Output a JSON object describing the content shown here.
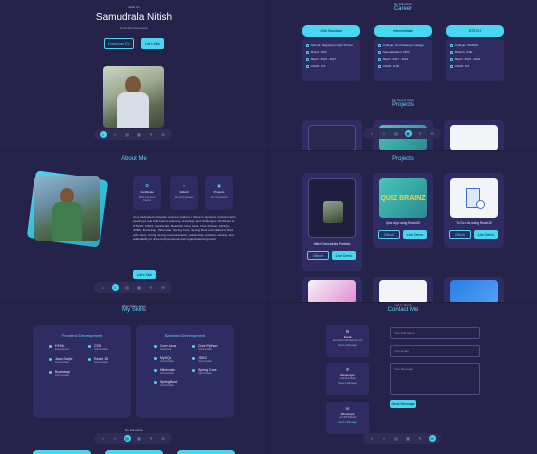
{
  "hero": {
    "greeting": "Hello I'm",
    "name": "Samudrala Nitish",
    "role": "Front-End Developer",
    "download_cv": "Download CV",
    "lets_talk": "Let's Talk"
  },
  "career": {
    "subtitle": "My Education",
    "title": "Career",
    "columns": [
      {
        "label": "10th Standard",
        "items": [
          "School: Nagarjuna High School",
          "Board: SSC",
          "Batch: 2019 - 2017",
          "CGPA: 9.5"
        ]
      },
      {
        "label": "Intermediate",
        "items": [
          "College: Sri Chaitanya College",
          "Specialization: MPC",
          "Batch: 2017 - 2019",
          "CGPA: 9.48"
        ]
      },
      {
        "label": "BTECH",
        "items": [
          "College: VIGNAN",
          "Branch: CSE",
          "Batch: 2019 - 2023",
          "CGPA: 8.6"
        ]
      }
    ],
    "projects_subtitle": "My Recent Work",
    "projects_title": "Projects"
  },
  "about": {
    "title": "About Me",
    "cards": [
      {
        "title": "Certificate",
        "sub": "Web, Frontend Course"
      },
      {
        "title": "GitHub",
        "sub": "20+ Repositories"
      },
      {
        "title": "Projects",
        "sub": "10+ Completed"
      }
    ],
    "bio": "As a dedicated computer science student, I thrive in dynamic environments seeking a role that fosters learning, creativity, and challenges. Proficient in HTML5, CSS3, JavaScript, ReactJS, Core Java, Core Python, MySQL, JDBC, Bootstrap, Hibernate, Spring Core, Spring Boot and skilled in DSA with Java. I bring strong communication, leadership, problem-solving, and adaptability to drive both personal and organizational growth.",
    "lets_talk": "Let's Talk"
  },
  "projects": {
    "title": "Projects",
    "items": [
      {
        "name": "Nitish Samudrala Portfolio",
        "a": "Github",
        "b": "Live Demo"
      },
      {
        "name": "Quiz App using ReactJS",
        "a": "Github",
        "b": "Live Demo"
      },
      {
        "name": "To Do List using ReactJS",
        "a": "Github",
        "b": "Live Demo"
      }
    ],
    "quiz_logo": "QUIZ BRAINZ"
  },
  "skills": {
    "subtitle": "What Skills I Have",
    "title": "My Skills",
    "frontend_title": "Frontend Development",
    "backend_title": "Backend Development",
    "frontend": [
      {
        "n": "HTML",
        "l": "Experienced"
      },
      {
        "n": "CSS",
        "l": "Intermediate"
      },
      {
        "n": "Java Script",
        "l": "Intermediate"
      },
      {
        "n": "React JS",
        "l": "Intermediate"
      },
      {
        "n": "Bootstrap",
        "l": "Intermediate"
      }
    ],
    "backend": [
      {
        "n": "Core Java",
        "l": "Advanced"
      },
      {
        "n": "Core Python",
        "l": "Intermediate"
      },
      {
        "n": "MySQL",
        "l": "Intermediate"
      },
      {
        "n": "JDBC",
        "l": "Intermediate"
      },
      {
        "n": "Hibernate",
        "l": "Intermediate"
      },
      {
        "n": "Spring Core",
        "l": "Intermediate"
      },
      {
        "n": "SpringBoot",
        "l": "Intermediate"
      }
    ],
    "footer_subtitle": "My Education"
  },
  "contact": {
    "subtitle": "Get In Touch",
    "title": "Contact Me",
    "cards": [
      {
        "t": "Email",
        "v": "samudrala.nitish@gmail.com",
        "a": "Send a Message"
      },
      {
        "t": "Messenger",
        "v": "nitishsamudrala",
        "a": "Send a Message"
      },
      {
        "t": "WhatsApp",
        "v": "+91 9876543210",
        "a": "Send a Message"
      }
    ],
    "name_ph": "Your Full Name",
    "email_ph": "Your Email",
    "msg_ph": "Your Message",
    "send": "Send Message"
  },
  "colors": {
    "accent": "#49d6f0",
    "bg": "#25234a",
    "card": "#2f2c63"
  }
}
